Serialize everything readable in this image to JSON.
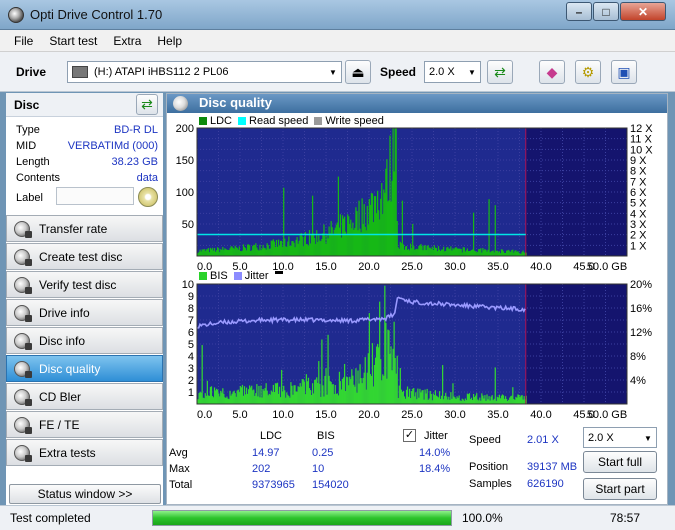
{
  "window": {
    "title": "Opti Drive Control 1.70"
  },
  "menu": [
    "File",
    "Start test",
    "Extra",
    "Help"
  ],
  "toolbar": {
    "drive_label": "Drive",
    "drive_value": "(H:)   ATAPI iHBS112   2 PL06",
    "speed_label": "Speed",
    "speed_value": "2.0 X"
  },
  "disc": {
    "title": "Disc",
    "rows": [
      {
        "key": "Type",
        "value": "BD-R DL"
      },
      {
        "key": "MID",
        "value": "VERBATIMd (000)"
      },
      {
        "key": "Length",
        "value": "38.23 GB"
      },
      {
        "key": "Contents",
        "value": "data"
      }
    ],
    "label_key": "Label"
  },
  "nav": [
    {
      "label": "Transfer rate",
      "active": false
    },
    {
      "label": "Create test disc",
      "active": false
    },
    {
      "label": "Verify test disc",
      "active": false
    },
    {
      "label": "Drive info",
      "active": false
    },
    {
      "label": "Disc info",
      "active": false
    },
    {
      "label": "Disc quality",
      "active": true
    },
    {
      "label": "CD Bler",
      "active": false
    },
    {
      "label": "FE / TE",
      "active": false
    },
    {
      "label": "Extra tests",
      "active": false
    }
  ],
  "status_window_label": "Status window >>",
  "panel_title": "Disc quality",
  "chart_data": [
    {
      "type": "area",
      "legend": [
        "LDC",
        "Read speed",
        "Write speed"
      ],
      "legend_colors": [
        "#0c8a0c",
        "#00ffff",
        "#9a9a9a"
      ],
      "x_ticks": [
        "0.0",
        "5.0",
        "10.0",
        "15.0",
        "20.0",
        "25.0",
        "30.0",
        "35.0",
        "40.0",
        "45.0",
        "50.0 GB"
      ],
      "xlim": [
        0,
        50
      ],
      "y_left_ticks": [
        "200",
        "150",
        "100",
        "50"
      ],
      "ylim": [
        0,
        200
      ],
      "y_right_ticks": [
        "12 X",
        "11 X",
        "10 X",
        "9 X",
        "8 X",
        "7 X",
        "6 X",
        "5 X",
        "4 X",
        "3 X",
        "2 X",
        "1 X"
      ],
      "y_right_lim": [
        0,
        12
      ],
      "data_end_gb": 38.23,
      "ldc_profile": {
        "x": [
          0,
          5,
          10,
          15,
          18,
          20,
          22,
          23,
          23.3,
          25,
          30,
          35,
          38.2
        ],
        "y": [
          8,
          12,
          20,
          35,
          55,
          75,
          110,
          175,
          18,
          14,
          10,
          8,
          6
        ]
      },
      "ldc_peak": {
        "x": 23,
        "y": 202
      },
      "read_speed_x": 2.01
    },
    {
      "type": "area",
      "legend": [
        "BIS",
        "Jitter"
      ],
      "legend_colors": [
        "#2ad22a",
        "#8c8cff"
      ],
      "x_ticks": [
        "0.0",
        "5.0",
        "10.0",
        "15.0",
        "20.0",
        "25.0",
        "30.0",
        "35.0",
        "40.0",
        "45.0",
        "50.0 GB"
      ],
      "xlim": [
        0,
        50
      ],
      "y_left_ticks": [
        "10",
        "9",
        "8",
        "7",
        "6",
        "5",
        "4",
        "3",
        "2",
        "1"
      ],
      "ylim": [
        0,
        10
      ],
      "y_right_ticks": [
        "20%",
        "16%",
        "12%",
        "8%",
        "4%"
      ],
      "y_right_lim": [
        0,
        20
      ],
      "bis_profile": {
        "x": [
          0,
          5,
          10,
          15,
          18,
          20,
          22,
          23,
          23.3,
          30,
          38.2
        ],
        "y": [
          1,
          1,
          1.2,
          1.5,
          2,
          3,
          4.5,
          7,
          1,
          0.6,
          0.5
        ]
      },
      "jitter_pct": {
        "x": [
          0,
          3,
          8,
          13,
          18,
          22,
          23,
          23.3,
          25,
          30,
          35,
          38.2
        ],
        "y": [
          13.0,
          13.6,
          14.0,
          14.0,
          13.9,
          14.3,
          15.0,
          17.8,
          17.0,
          16.5,
          16.0,
          15.8
        ]
      }
    }
  ],
  "stats": {
    "col_ldc": "LDC",
    "col_bis": "BIS",
    "col_jitter": "Jitter",
    "rows": [
      {
        "label": "Avg",
        "ldc": "14.97",
        "bis": "0.25",
        "jitter": "14.0%"
      },
      {
        "label": "Max",
        "ldc": "202",
        "bis": "10",
        "jitter": "18.4%"
      },
      {
        "label": "Total",
        "ldc": "9373965",
        "bis": "154020",
        "jitter": ""
      }
    ],
    "speed_label": "Speed",
    "speed_value": "2.01 X",
    "position_label": "Position",
    "position_value": "39137 MB",
    "samples_label": "Samples",
    "samples_value": "626190",
    "speed_select": "2.0 X",
    "start_full": "Start full",
    "start_part": "Start part"
  },
  "status": {
    "text": "Test completed",
    "progress_pct": 100.0,
    "progress_label": "100.0%",
    "time": "78:57"
  }
}
